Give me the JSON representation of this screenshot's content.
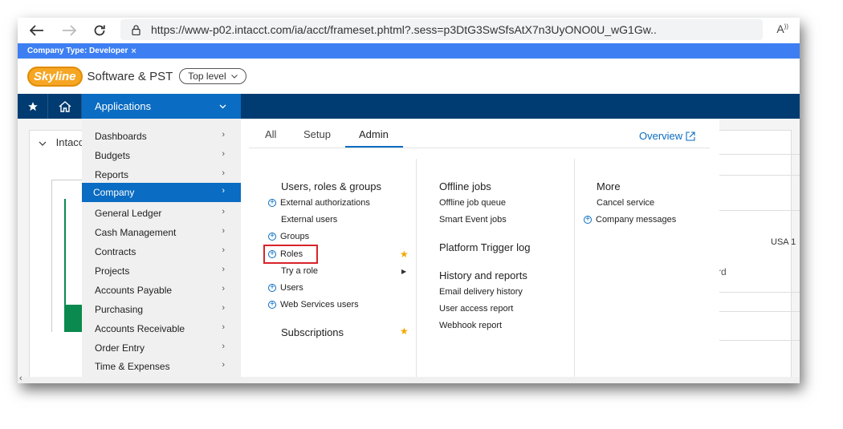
{
  "browser": {
    "url": "https://www-p02.intacct.com/ia/acct/frameset.phtml?.sess=p3DtG3SwSfsAtX7n3UyONO0U_wG1Gw..",
    "reader_icon": "A"
  },
  "company_strip": {
    "label": "Company Type: Developer",
    "close": "×"
  },
  "header": {
    "logo": "Skyline",
    "company": "Software & PST",
    "level": "Top level"
  },
  "navbar": {
    "applications": "Applications"
  },
  "background": {
    "collapse_label": "Intacct",
    "usa": "USA 1",
    "partial": "rd"
  },
  "left_menu": [
    {
      "label": "Dashboards"
    },
    {
      "label": "Budgets"
    },
    {
      "label": "Reports"
    },
    {
      "label": "Company",
      "active": true
    },
    {
      "label": "General Ledger"
    },
    {
      "label": "Cash Management"
    },
    {
      "label": "Contracts"
    },
    {
      "label": "Projects"
    },
    {
      "label": "Accounts Payable"
    },
    {
      "label": "Purchasing"
    },
    {
      "label": "Accounts Receivable"
    },
    {
      "label": "Order Entry"
    },
    {
      "label": "Time & Expenses"
    }
  ],
  "tabs": [
    {
      "label": "All"
    },
    {
      "label": "Setup"
    },
    {
      "label": "Admin",
      "active": true
    }
  ],
  "overview": "Overview",
  "col1": {
    "title": "Users, roles & groups",
    "links": [
      "External authorizations",
      "External users",
      "Groups",
      "Roles",
      "Try a role",
      "Users",
      "Web Services users"
    ],
    "subscriptions": "Subscriptions"
  },
  "col2": {
    "offline_title": "Offline jobs",
    "offline_links": [
      "Offline job queue",
      "Smart Event jobs"
    ],
    "platform_title": "Platform Trigger log",
    "history_title": "History and reports",
    "history_links": [
      "Email delivery history",
      "User access report",
      "Webhook report"
    ]
  },
  "col3": {
    "title": "More",
    "links": [
      "Cancel service",
      "Company messages"
    ]
  },
  "colors": {
    "navy": "#003b71",
    "accent": "#0a6cc2",
    "strip": "#3d7ff2",
    "highlight": "#d8232a",
    "star": "#f2a900"
  }
}
